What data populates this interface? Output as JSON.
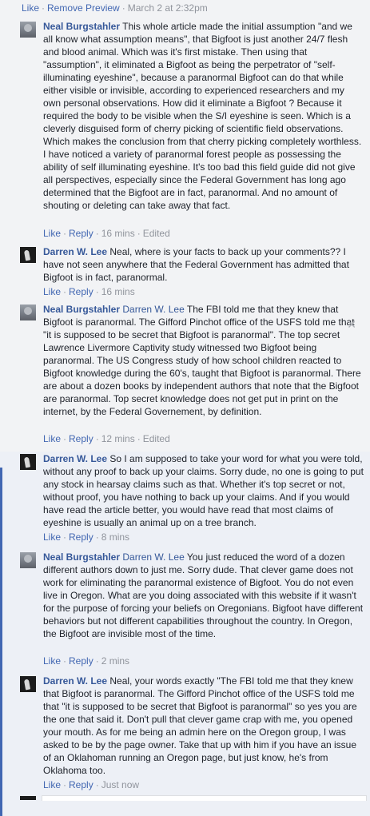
{
  "top_actions": {
    "like": "Like",
    "remove_preview": "Remove Preview",
    "timestamp": "March 2 at 2:32pm"
  },
  "comments": [
    {
      "author": "Neal Burgstahler",
      "mention": "",
      "text": "This whole article made the initial assumption \"and we all know what assumption means\", that Bigfoot is just another 24/7 flesh and blood animal. Which was it's first mistake. Then using that \"assumption\", it eliminated a Bigfoot as being the perpetrator of \"self-illuminating eyeshine\", because a paranormal Bigfoot can do that while either visible or invisible, according to experienced researchers and my own personal observations. How did it eliminate a Bigfoot ? Because it required the body to be visible when the S/I eyeshine is seen. Which is a cleverly disguised form of cherry picking of scientific field observations. Which makes the conclusion from that cherry picking completely worthless. I have noticed a variety of paranormal forest people as possessing the ability of self illuminating eyeshine. It's too bad this field guide did not give all perspectives, especially since the Federal Government has long ago determined that the Bigfoot are in fact, paranormal. And no amount of shouting or deleting can take away that fact.",
      "like": "Like",
      "reply": "Reply",
      "time": "16 mins",
      "edited": "Edited"
    },
    {
      "author": "Darren W. Lee",
      "mention": "",
      "text": "Neal, where is your facts to back up your comments?? I have not seen anywhere that the Federal Government has admitted that Bigfoot is in fact, paranormal.",
      "like": "Like",
      "reply": "Reply",
      "time": "16 mins",
      "edited": ""
    },
    {
      "author": "Neal Burgstahler",
      "mention": "Darren W. Lee",
      "text": "The FBI told me that they knew that Bigfoot is paranormal. The Gifford Pinchot office of the USFS told me that \"it is supposed to be secret that Bigfoot is paranormal\". The top secret Lawrence Livermore Captivity study witnessed two Bigfoot being paranormal. The US Congress study of how school children reacted to Bigfoot knowledge during the 60's, taught that Bigfoot is paranormal. There are about a dozen books by independent authors that note that the Bigfoot are paranormal. Top secret knowledge does not get put in print on the internet, by the Federal Governement, by definition.",
      "like": "Like",
      "reply": "Reply",
      "time": "12 mins",
      "edited": "Edited"
    },
    {
      "author": "Darren W. Lee",
      "mention": "",
      "text": "So I am supposed to take your word for what you were told, without any proof to back up your claims. Sorry dude, no one is going to put any stock in hearsay claims such as that. Whether it's top secret or not, without proof, you have nothing to back up your claims. And if you would have read the article better, you would have read that most claims of eyeshine is usually an animal up on a tree branch.",
      "like": "Like",
      "reply": "Reply",
      "time": "8 mins",
      "edited": ""
    },
    {
      "author": "Neal Burgstahler",
      "mention": "Darren W. Lee",
      "text": "You just reduced the word of a dozen different authors down to just me. Sorry dude. That clever game does not work for eliminating the paranormal existence of Bigfoot. You do not even live in Oregon. What are you doing associated with this website if it wasn't for the purpose of forcing your beliefs on Oregonians. Bigfoot have different behaviors but not different capabilities throughout the country. In Oregon, the Bigfoot are invisible most of the time.",
      "like": "Like",
      "reply": "Reply",
      "time": "2 mins",
      "edited": ""
    },
    {
      "author": "Darren W. Lee",
      "mention": "",
      "text": "Neal, your words exactly \"The FBI told me that they knew that Bigfoot is paranormal. The Gifford Pinchot office of the USFS told me that \"it is supposed to be secret that Bigfoot is paranormal\" so yes you are the one that said it. Don't pull that clever game crap with me, you opened your mouth. As for me being an admin here on the Oregon group, I was asked to be by the page owner. Take that up with him if you have an issue of an Oklahoman running an Oregon page, but just know, he's from Oklahoma too.",
      "like": "Like",
      "reply": "Reply",
      "time": "Just now",
      "edited": ""
    }
  ],
  "icons": {
    "close": "close-icon"
  }
}
